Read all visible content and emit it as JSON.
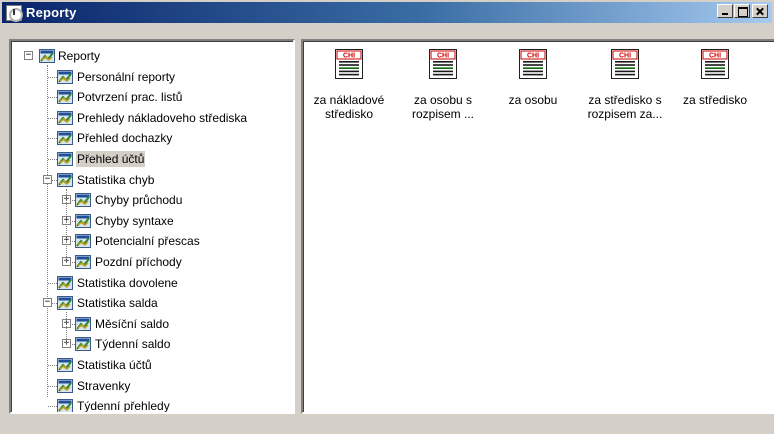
{
  "window": {
    "title": "Reporty",
    "buttons": {
      "minimize": "minimize",
      "maximize": "maximize",
      "close": "close"
    }
  },
  "tree": {
    "root": {
      "label": "Reporty",
      "expander": "−"
    },
    "items": [
      {
        "label": "Personální reporty",
        "depth": 1
      },
      {
        "label": "Potvrzení prac. listů",
        "depth": 1
      },
      {
        "label": "Prehledy nákladoveho střediska",
        "depth": 1
      },
      {
        "label": "Přehled dochazky",
        "depth": 1
      },
      {
        "label": "Přehled účtů",
        "depth": 1,
        "selected": true
      },
      {
        "label": "Statistika chyb",
        "depth": 1,
        "expander": "−"
      },
      {
        "label": "Chyby průchodu",
        "depth": 2,
        "expander": "+"
      },
      {
        "label": "Chyby syntaxe",
        "depth": 2,
        "expander": "+"
      },
      {
        "label": "Potencialní přescas",
        "depth": 2,
        "expander": "+"
      },
      {
        "label": "Pozdní příchody",
        "depth": 2,
        "expander": "+"
      },
      {
        "label": "Statistika dovolene",
        "depth": 1
      },
      {
        "label": "Statistika salda",
        "depth": 1,
        "expander": "−"
      },
      {
        "label": "Měsíční saldo",
        "depth": 2,
        "expander": "+"
      },
      {
        "label": "Týdenní saldo",
        "depth": 2,
        "expander": "+"
      },
      {
        "label": "Statistika účtů",
        "depth": 1
      },
      {
        "label": "Stravenky",
        "depth": 1
      },
      {
        "label": "Týdenní přehledy",
        "depth": 1
      }
    ]
  },
  "list": {
    "items": [
      {
        "line1": "za nákladové",
        "line2": "středisko"
      },
      {
        "line1": "za osobu s",
        "line2": "rozpisem ..."
      },
      {
        "line1": "za osobu",
        "line2": ""
      },
      {
        "line1": "za středisko s",
        "line2": "rozpisem za..."
      },
      {
        "line1": "za středisko",
        "line2": ""
      }
    ],
    "icon_text": "CHI"
  },
  "colors": {
    "titlebar_start": "#0a246a",
    "titlebar_end": "#a6caf0",
    "face": "#d4d0c8",
    "report_icon_red": "#cc0000",
    "report_icon_green": "#008000"
  },
  "icons": {
    "tree_node": "report-folder-icon",
    "list_tile": "report-document-icon",
    "app": "clock-icon"
  }
}
